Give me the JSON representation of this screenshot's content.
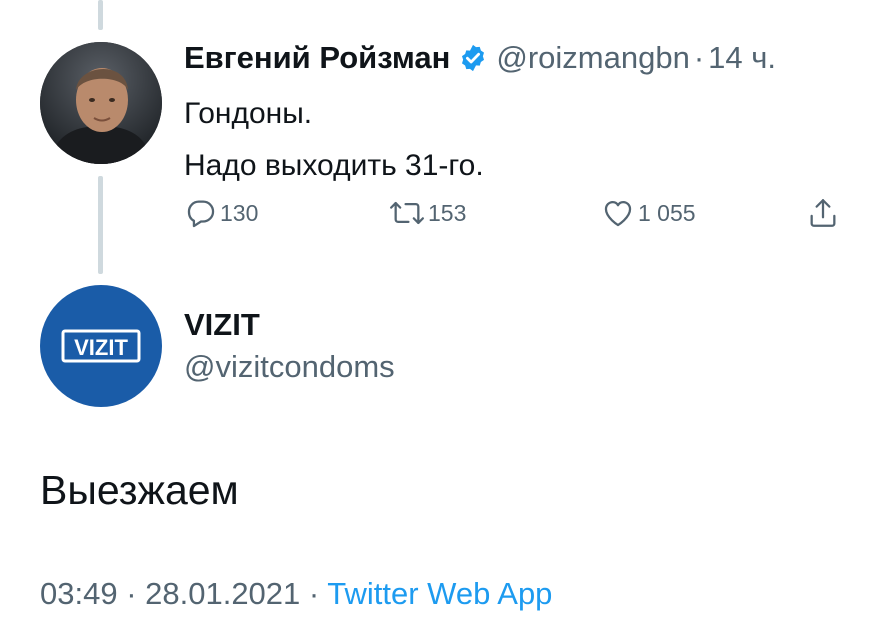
{
  "parent_tweet": {
    "display_name": "Евгений Ройзман",
    "handle": "@roizmangbn",
    "separator": "·",
    "time": "14 ч.",
    "text_lines": [
      "Гондоны.",
      "Надо выходить 31-го."
    ],
    "replies": "130",
    "retweets": "153",
    "likes": "1 055",
    "icons": {
      "verified": "verified-badge-icon",
      "reply": "speech-bubble-icon",
      "retweet": "retweet-arrows-icon",
      "like": "heart-icon",
      "share": "share-upload-icon"
    }
  },
  "main_tweet": {
    "display_name": "VIZIT",
    "handle": "@vizitcondoms",
    "avatar_logo_text": "VIZIT",
    "text": "Выезжаем",
    "timestamp": "03:49 · 28.01.2021",
    "meta_separator": " · ",
    "source": "Twitter Web App"
  },
  "colors": {
    "text_primary": "#0f1419",
    "text_secondary": "#536471",
    "accent_blue": "#1d9bf0",
    "vizit_brand_blue": "#1a5ca8",
    "thread_line": "#cfd9de"
  }
}
